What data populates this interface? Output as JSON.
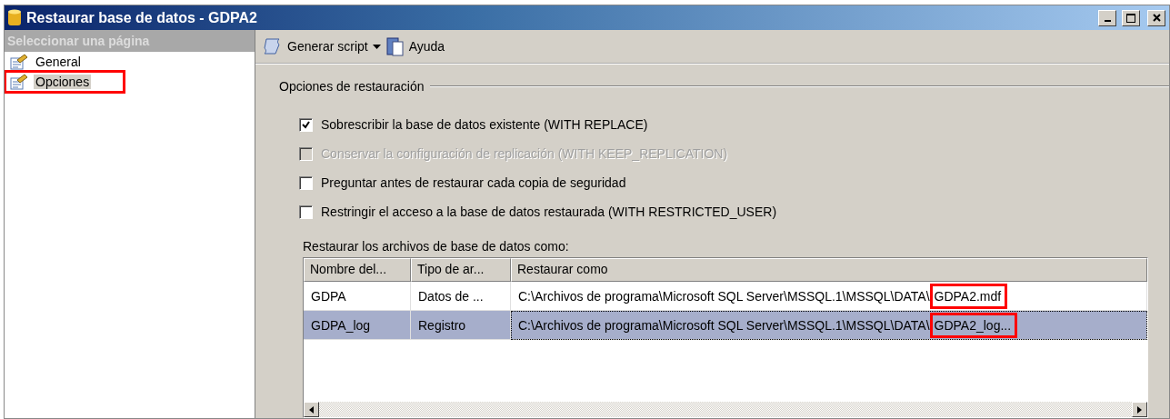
{
  "window": {
    "title": "Restaurar base de datos - GDPA2"
  },
  "sidebar": {
    "header": "Seleccionar una página",
    "items": [
      {
        "label": "General",
        "selected": false,
        "highlighted": false
      },
      {
        "label": "Opciones",
        "selected": true,
        "highlighted": true
      }
    ]
  },
  "toolbar": {
    "items": [
      {
        "label": "Generar script",
        "kind": "dropdown"
      },
      {
        "label": "Ayuda",
        "kind": "help"
      }
    ]
  },
  "options": {
    "title": "Opciones de restauración",
    "checkboxes": [
      {
        "label": "Sobrescribir la base de datos existente (WITH REPLACE)",
        "checked": true,
        "disabled": false
      },
      {
        "label": "Conservar la configuración de replicación (WITH KEEP_REPLICATION)",
        "checked": false,
        "disabled": true
      },
      {
        "label": "Preguntar antes de restaurar cada copia de seguridad",
        "checked": false,
        "disabled": false
      },
      {
        "label": "Restringir el acceso a la base de datos restaurada (WITH RESTRICTED_USER)",
        "checked": false,
        "disabled": false
      }
    ]
  },
  "files": {
    "label": "Restaurar los archivos de base de datos como:",
    "columns": [
      "Nombre del...",
      "Tipo de ar...",
      "Restaurar como"
    ],
    "rows": [
      {
        "name": "GDPA",
        "type": "Datos de ...",
        "path": "C:\\Archivos de programa\\Microsoft SQL Server\\MSSQL.1\\MSSQL\\DATA\\",
        "file": "GDPA2.mdf",
        "selected": false,
        "highlighted": true
      },
      {
        "name": "GDPA_log",
        "type": "Registro",
        "path": "C:\\Archivos de programa\\Microsoft SQL Server\\MSSQL.1\\MSSQL\\DATA\\",
        "file": "GDPA2_log...",
        "selected": true,
        "highlighted": true
      }
    ]
  }
}
